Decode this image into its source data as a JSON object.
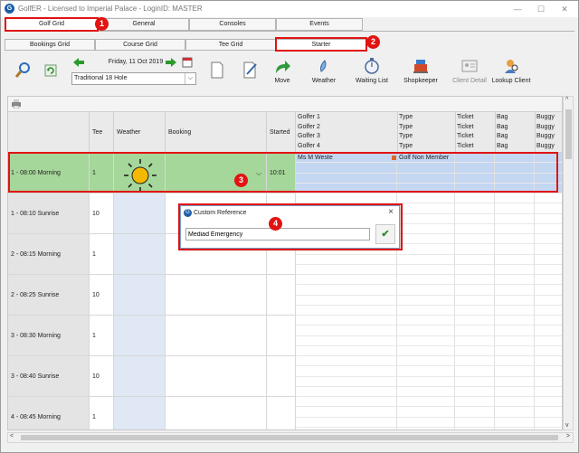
{
  "window": {
    "title": "GolfER - Licensed to Imperial Palace - LoginID: MASTER",
    "app_icon": "golfer-logo-icon",
    "controls": [
      "—",
      "☐",
      "✕"
    ]
  },
  "main_tabs": [
    {
      "label": "Golf Grid",
      "active": true
    },
    {
      "label": "General",
      "active": false
    },
    {
      "label": "Consoles",
      "active": false
    },
    {
      "label": "Events",
      "active": false
    }
  ],
  "sub_tabs": [
    {
      "label": "Bookings Grid",
      "active": false
    },
    {
      "label": "Course Grid",
      "active": false
    },
    {
      "label": "Tee Grid",
      "active": false
    },
    {
      "label": "Starter",
      "active": true
    }
  ],
  "toolbar": {
    "date": "Friday, 11 Oct 2019",
    "course": "Traditional 18 Hole",
    "buttons": [
      {
        "label": "Move",
        "icon": "move-arrow-icon",
        "enabled": true
      },
      {
        "label": "Weather",
        "icon": "weather-icon",
        "enabled": true
      },
      {
        "label": "Waiting List",
        "icon": "stopwatch-icon",
        "enabled": true
      },
      {
        "label": "Shopkeeper",
        "icon": "cash-register-icon",
        "enabled": true
      },
      {
        "label": "Client Detail",
        "icon": "client-card-icon",
        "enabled": false
      },
      {
        "label": "Lookup Client",
        "icon": "lookup-client-icon",
        "enabled": true
      }
    ]
  },
  "grid": {
    "headers": {
      "tee": "Tee",
      "weather": "Weather",
      "booking": "Booking",
      "started": "Started",
      "golfer_rows": [
        [
          "Golfer 1",
          "Type",
          "Ticket",
          "Bag",
          "Buggy"
        ],
        [
          "Golfer 2",
          "Type",
          "Ticket",
          "Bag",
          "Buggy"
        ],
        [
          "Golfer 3",
          "Type",
          "Ticket",
          "Bag",
          "Buggy"
        ],
        [
          "Golfer 4",
          "Type",
          "Ticket",
          "Bag",
          "Buggy"
        ]
      ]
    },
    "rows": [
      {
        "time": "1 - 08:00 Morning",
        "tee": "1",
        "started": "10:01",
        "selected": true,
        "golfer_name": "Ms M Weste",
        "golfer_type": "Golf Non Member"
      },
      {
        "time": "1 - 08:10 Sunrise",
        "tee": "10",
        "started": "",
        "selected": false
      },
      {
        "time": "2 - 08:15 Morning",
        "tee": "1",
        "started": "",
        "selected": false
      },
      {
        "time": "2 - 08:25 Sunrise",
        "tee": "10",
        "started": "",
        "selected": false
      },
      {
        "time": "3 - 08:30 Morning",
        "tee": "1",
        "started": "",
        "selected": false
      },
      {
        "time": "3 - 08:40 Sunrise",
        "tee": "10",
        "started": "",
        "selected": false
      },
      {
        "time": "4 - 08:45 Morning",
        "tee": "1",
        "started": "",
        "selected": false
      }
    ]
  },
  "dialog": {
    "title": "Custom Reference",
    "value": "Mediad Emergency"
  },
  "callouts": [
    "1",
    "2",
    "3",
    "4"
  ],
  "colors": {
    "callout_red": "#e11313",
    "selected_row_green": "#a5d69a",
    "selected_golfer_blue": "#c3d7f2",
    "sun_yellow": "#f5b800"
  }
}
